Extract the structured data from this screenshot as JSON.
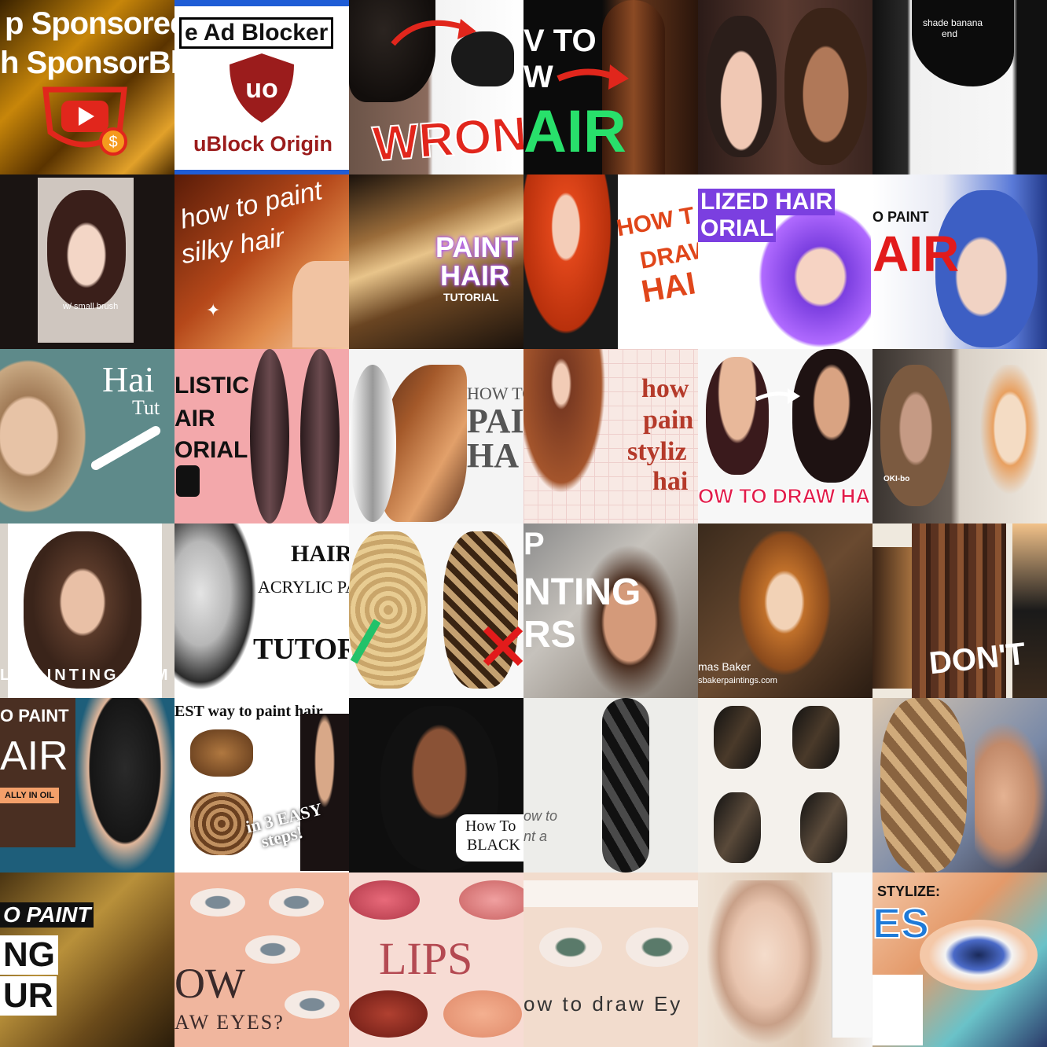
{
  "grid": {
    "tiles": [
      {
        "texts": [
          "p Sponsored",
          "h SponsorBlo"
        ]
      },
      {
        "texts": [
          "e Ad Blocker",
          "uBlock Origin"
        ]
      },
      {
        "texts": [
          "WRONG"
        ]
      },
      {
        "texts": [
          "V TO",
          "W",
          "AIR"
        ]
      },
      {
        "texts": []
      },
      {
        "texts": [
          "shade banana",
          "end"
        ]
      },
      {
        "texts": [
          "w/ small brush"
        ]
      },
      {
        "texts": [
          "how to paint",
          "silky hair"
        ]
      },
      {
        "texts": [
          "PAINT",
          "HAIR",
          "TUTORIAL"
        ]
      },
      {
        "texts": [
          "HOW T",
          "DRAW",
          "HAI"
        ]
      },
      {
        "texts": [
          "LIZED HAIR",
          "ORIAL"
        ]
      },
      {
        "texts": [
          "O PAINT",
          "AIR"
        ]
      },
      {
        "texts": [
          "Hai",
          "Tut"
        ]
      },
      {
        "texts": [
          "LISTIC",
          "AIR",
          "ORIAL"
        ]
      },
      {
        "texts": [
          "HOW TO",
          "PAI",
          "HA"
        ]
      },
      {
        "texts": [
          "how",
          "pain",
          "styliz",
          "hai"
        ]
      },
      {
        "texts": [
          "OW TO DRAW HA"
        ]
      },
      {
        "texts": [
          "OKI-bo"
        ]
      },
      {
        "texts": [
          "L PAINTING DEM"
        ]
      },
      {
        "texts": [
          "HAIR",
          "ACRYLIC PAIN",
          "TUTOR"
        ]
      },
      {
        "texts": []
      },
      {
        "texts": [
          "P",
          "NTING",
          "RS"
        ]
      },
      {
        "texts": [
          "mas Baker",
          "sbakerpaintings.com"
        ]
      },
      {
        "texts": [
          "DON'T"
        ]
      },
      {
        "texts": [
          "O PAINT",
          "AIR",
          "ALLY IN OIL"
        ]
      },
      {
        "texts": [
          "EST way to paint hair",
          "in 3 EASY",
          "steps!"
        ]
      },
      {
        "texts": [
          "How To",
          "BLACK"
        ]
      },
      {
        "texts": [
          "ow to",
          "nt a"
        ]
      },
      {
        "texts": []
      },
      {
        "texts": []
      },
      {
        "texts": [
          "O PAINT",
          "NG",
          "UR"
        ]
      },
      {
        "texts": [
          "OW",
          "AW EYES?"
        ]
      },
      {
        "texts": [
          "LIPS"
        ]
      },
      {
        "texts": [
          "ow to draw Ey"
        ]
      },
      {
        "texts": []
      },
      {
        "texts": [
          "STYLIZE:",
          "ES"
        ]
      }
    ]
  },
  "colors": {
    "youtube_red": "#e1261c",
    "ublock_red": "#9b1c1c",
    "accent_purple": "#a64cff"
  }
}
